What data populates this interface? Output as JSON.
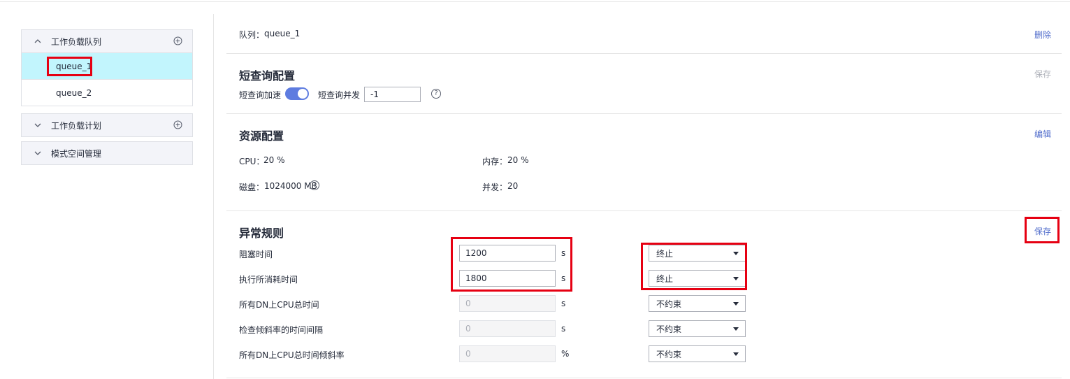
{
  "sidebar": {
    "workload_queue": {
      "title": "工作负载队列",
      "items": [
        {
          "label": "queue_1",
          "active": true
        },
        {
          "label": "queue_2",
          "active": false
        }
      ]
    },
    "workload_plan": {
      "title": "工作负载计划"
    },
    "schema_space": {
      "title": "模式空间管理"
    }
  },
  "queue_header": {
    "label": "队列：",
    "value": "queue_1",
    "delete_label": "删除"
  },
  "short_query": {
    "title": "短查询配置",
    "save_label": "保存",
    "accel_label": "短查询加速",
    "accel_enabled": true,
    "concurrency_label": "短查询并发",
    "concurrency_value": "-1"
  },
  "resource": {
    "title": "资源配置",
    "edit_label": "编辑",
    "cpu_label": "CPU：",
    "cpu_value": "20 %",
    "memory_label": "内存：",
    "memory_value": "20 %",
    "disk_label": "磁盘：",
    "disk_value": "1024000 MB",
    "concurrency_label": "并发：",
    "concurrency_value": "20"
  },
  "exception_rules": {
    "title": "异常规则",
    "save_label": "保存",
    "rows": [
      {
        "label": "阻塞时间",
        "value": "1200",
        "unit": "s",
        "action": "终止",
        "enabled": true
      },
      {
        "label": "执行所消耗时间",
        "value": "1800",
        "unit": "s",
        "action": "终止",
        "enabled": true
      },
      {
        "label": "所有DN上CPU总时间",
        "value": "0",
        "unit": "s",
        "action": "不约束",
        "enabled": false
      },
      {
        "label": "检查倾斜率的时间间隔",
        "value": "0",
        "unit": "s",
        "action": "不约束",
        "enabled": false
      },
      {
        "label": "所有DN上CPU总时间倾斜率",
        "value": "0",
        "unit": "%",
        "action": "不约束",
        "enabled": false
      }
    ]
  },
  "icons": {
    "help": "?"
  },
  "colors": {
    "accent": "#5e7ce0",
    "link": "#526ecc",
    "highlight": "#e60012",
    "active_row": "#c2f5fd"
  }
}
